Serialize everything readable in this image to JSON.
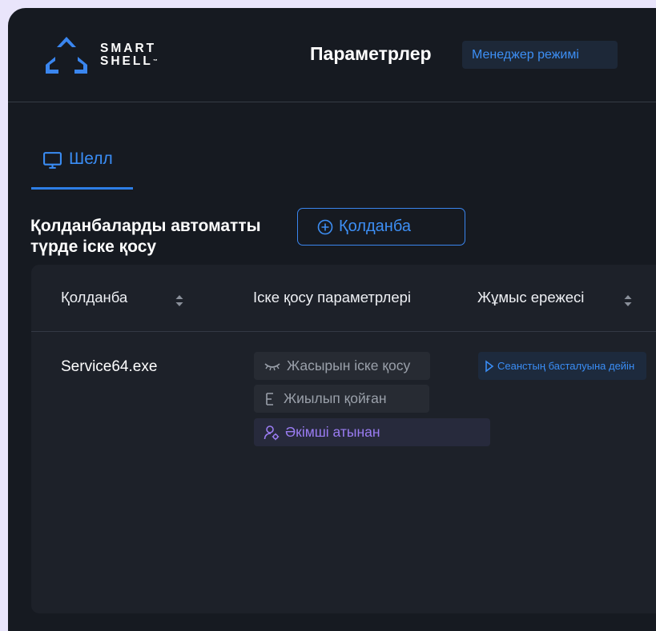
{
  "app": {
    "logo_line1": "SMART",
    "logo_line2": "SHELL",
    "logo_tm": "™",
    "page_title": "Параметрлер",
    "mode_badge": "Менеджер режимі"
  },
  "tabs": [
    {
      "label": "Шелл",
      "icon": "monitor-icon",
      "active": true
    }
  ],
  "section": {
    "title": "Қолданбаларды автоматты түрде іске қосу",
    "add_button": "Қолданба"
  },
  "table": {
    "columns": [
      {
        "label": "Қолданба",
        "sortable": true
      },
      {
        "label": "Іске қосу параметрлері",
        "sortable": false
      },
      {
        "label": "Жұмыс ережесі",
        "sortable": true
      }
    ],
    "rows": [
      {
        "app": "Service64.exe",
        "params": [
          {
            "label": "Жасырын іске қосу",
            "icon": "eye-closed-icon"
          },
          {
            "label": "Жиылып қойған",
            "icon": "minimize-icon"
          },
          {
            "label": "Әкімші атынан",
            "icon": "user-admin-icon"
          }
        ],
        "rule": "Сеанстың басталуына дейін"
      }
    ]
  },
  "colors": {
    "accent": "#3a8df5",
    "admin_purple": "#9a7cf2",
    "background": "#161a21",
    "panel": "#1d2129"
  }
}
